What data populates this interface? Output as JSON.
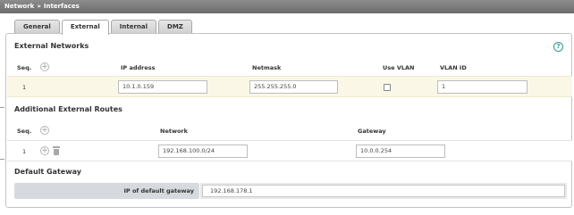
{
  "breadcrumb": {
    "section": "Network",
    "separator": "»",
    "page": "Interfaces"
  },
  "tabs": [
    {
      "label": "General",
      "active": false
    },
    {
      "label": "External",
      "active": true
    },
    {
      "label": "Internal",
      "active": false
    },
    {
      "label": "DMZ",
      "active": false
    }
  ],
  "external_networks": {
    "title": "External Networks",
    "headers": {
      "seq": "Seq.",
      "ip": "IP address",
      "netmask": "Netmask",
      "use_vlan": "Use VLAN",
      "vlan_id": "VLAN ID"
    },
    "rows": [
      {
        "seq": "1",
        "ip": "10.1.0.159",
        "netmask": "255.255.255.0",
        "use_vlan": false,
        "vlan_id": "1"
      }
    ]
  },
  "routes": {
    "title": "Additional External Routes",
    "headers": {
      "seq": "Seq.",
      "network": "Network",
      "gateway": "Gateway"
    },
    "rows": [
      {
        "seq": "1",
        "network": "192.168.100.0/24",
        "gateway": "10.0.0.254"
      }
    ]
  },
  "default_gateway": {
    "title": "Default Gateway",
    "label": "IP of default gateway",
    "value": "192.168.178.1"
  },
  "icons": {
    "help": "help-icon",
    "add": "add-icon",
    "delete": "trash-icon"
  },
  "colors": {
    "accent": "#2a9d8f",
    "row_highlight": "#fbf7e6",
    "titlebar": "#7a7a7a"
  }
}
